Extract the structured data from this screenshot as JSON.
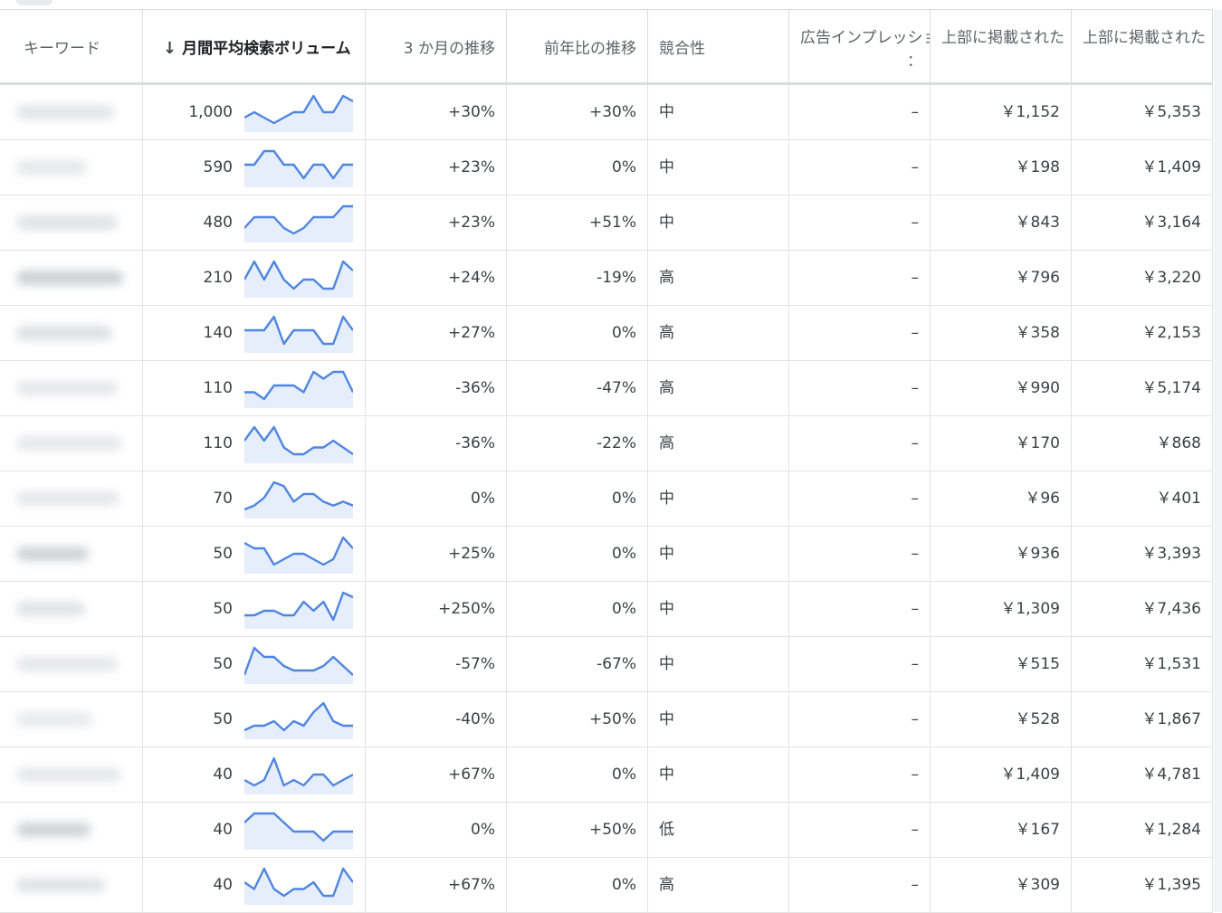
{
  "headers": {
    "keyword": "キーワード",
    "sort_arrow": "↓",
    "volume": "月間平均検索ボリューム",
    "three_month": "3 か月の推移",
    "yoy": "前年比の推移",
    "competition": "競合性",
    "impression_share": "広告インプレッション",
    "impression_share_sub": "：",
    "top_bid_low": "上部に掲載された",
    "top_bid_high": "上部に掲載された"
  },
  "rows": [
    {
      "keyword": "",
      "volume": "1,000",
      "trend": [
        3,
        4,
        3,
        2,
        3,
        4,
        4,
        7,
        4,
        4,
        7,
        6
      ],
      "three_month": "+30%",
      "yoy": "+30%",
      "competition": "中",
      "impression_share": "–",
      "bid_low": "￥1,152",
      "bid_high": "￥5,353"
    },
    {
      "keyword": "",
      "volume": "590",
      "trend": [
        3,
        3,
        5,
        5,
        3,
        3,
        1,
        3,
        3,
        1,
        3,
        3
      ],
      "three_month": "+23%",
      "yoy": "0%",
      "competition": "中",
      "impression_share": "–",
      "bid_low": "￥198",
      "bid_high": "￥1,409"
    },
    {
      "keyword": "",
      "volume": "480",
      "trend": [
        2,
        4,
        4,
        4,
        2,
        1,
        2,
        4,
        4,
        4,
        6,
        6
      ],
      "three_month": "+23%",
      "yoy": "+51%",
      "competition": "中",
      "impression_share": "–",
      "bid_low": "￥843",
      "bid_high": "￥3,164"
    },
    {
      "keyword": "",
      "volume": "210",
      "trend": [
        4,
        6,
        4,
        6,
        4,
        3,
        4,
        4,
        3,
        3,
        6,
        5
      ],
      "three_month": "+24%",
      "yoy": "-19%",
      "competition": "高",
      "impression_share": "–",
      "bid_low": "￥796",
      "bid_high": "￥3,220"
    },
    {
      "keyword": "",
      "volume": "140",
      "trend": [
        3,
        3,
        3,
        5,
        1,
        3,
        3,
        3,
        1,
        1,
        5,
        3
      ],
      "three_month": "+27%",
      "yoy": "0%",
      "competition": "高",
      "impression_share": "–",
      "bid_low": "￥358",
      "bid_high": "￥2,153"
    },
    {
      "keyword": "",
      "volume": "110",
      "trend": [
        2,
        2,
        1,
        3,
        3,
        3,
        2,
        5,
        4,
        5,
        5,
        2
      ],
      "three_month": "-36%",
      "yoy": "-47%",
      "competition": "高",
      "impression_share": "–",
      "bid_low": "￥990",
      "bid_high": "￥5,174"
    },
    {
      "keyword": "",
      "volume": "110",
      "trend": [
        5,
        7,
        5,
        7,
        4,
        3,
        3,
        4,
        4,
        5,
        4,
        3
      ],
      "three_month": "-36%",
      "yoy": "-22%",
      "competition": "高",
      "impression_share": "–",
      "bid_low": "￥170",
      "bid_high": "￥868"
    },
    {
      "keyword": "",
      "volume": "70",
      "trend": [
        1,
        2,
        4,
        8,
        7,
        3,
        5,
        5,
        3,
        2,
        3,
        2
      ],
      "three_month": "0%",
      "yoy": "0%",
      "competition": "中",
      "impression_share": "–",
      "bid_low": "￥96",
      "bid_high": "￥401"
    },
    {
      "keyword": "",
      "volume": "50",
      "trend": [
        6,
        5,
        5,
        2,
        3,
        4,
        4,
        3,
        2,
        3,
        7,
        5
      ],
      "three_month": "+25%",
      "yoy": "0%",
      "competition": "中",
      "impression_share": "–",
      "bid_low": "￥936",
      "bid_high": "￥3,393"
    },
    {
      "keyword": "",
      "volume": "50",
      "trend": [
        2,
        2,
        3,
        3,
        2,
        2,
        5,
        3,
        5,
        1,
        7,
        6
      ],
      "three_month": "+250%",
      "yoy": "0%",
      "competition": "中",
      "impression_share": "–",
      "bid_low": "￥1,309",
      "bid_high": "￥7,436"
    },
    {
      "keyword": "",
      "volume": "50",
      "trend": [
        2,
        8,
        6,
        6,
        4,
        3,
        3,
        3,
        4,
        6,
        4,
        2
      ],
      "three_month": "-57%",
      "yoy": "-67%",
      "competition": "中",
      "impression_share": "–",
      "bid_low": "￥515",
      "bid_high": "￥1,531"
    },
    {
      "keyword": "",
      "volume": "50",
      "trend": [
        2,
        3,
        3,
        4,
        2,
        4,
        3,
        6,
        8,
        4,
        3,
        3
      ],
      "three_month": "-40%",
      "yoy": "+50%",
      "competition": "中",
      "impression_share": "–",
      "bid_low": "￥528",
      "bid_high": "￥1,867"
    },
    {
      "keyword": "",
      "volume": "40",
      "trend": [
        3,
        2,
        3,
        7,
        2,
        3,
        2,
        4,
        4,
        2,
        3,
        4
      ],
      "three_month": "+67%",
      "yoy": "0%",
      "competition": "中",
      "impression_share": "–",
      "bid_low": "￥1,409",
      "bid_high": "￥4,781"
    },
    {
      "keyword": "",
      "volume": "40",
      "trend": [
        4,
        5,
        5,
        5,
        4,
        3,
        3,
        3,
        2,
        3,
        3,
        3
      ],
      "three_month": "0%",
      "yoy": "+50%",
      "competition": "低",
      "impression_share": "–",
      "bid_low": "￥167",
      "bid_high": "￥1,284"
    },
    {
      "keyword": "",
      "volume": "40",
      "trend": [
        3,
        2,
        5,
        2,
        1,
        2,
        2,
        3,
        1,
        1,
        5,
        3
      ],
      "three_month": "+67%",
      "yoy": "0%",
      "competition": "高",
      "impression_share": "–",
      "bid_low": "￥309",
      "bid_high": "￥1,395"
    }
  ],
  "colors": {
    "sparkline_stroke": "#4f86e0",
    "sparkline_fill": "#e6eefb",
    "border": "#dadce0"
  }
}
